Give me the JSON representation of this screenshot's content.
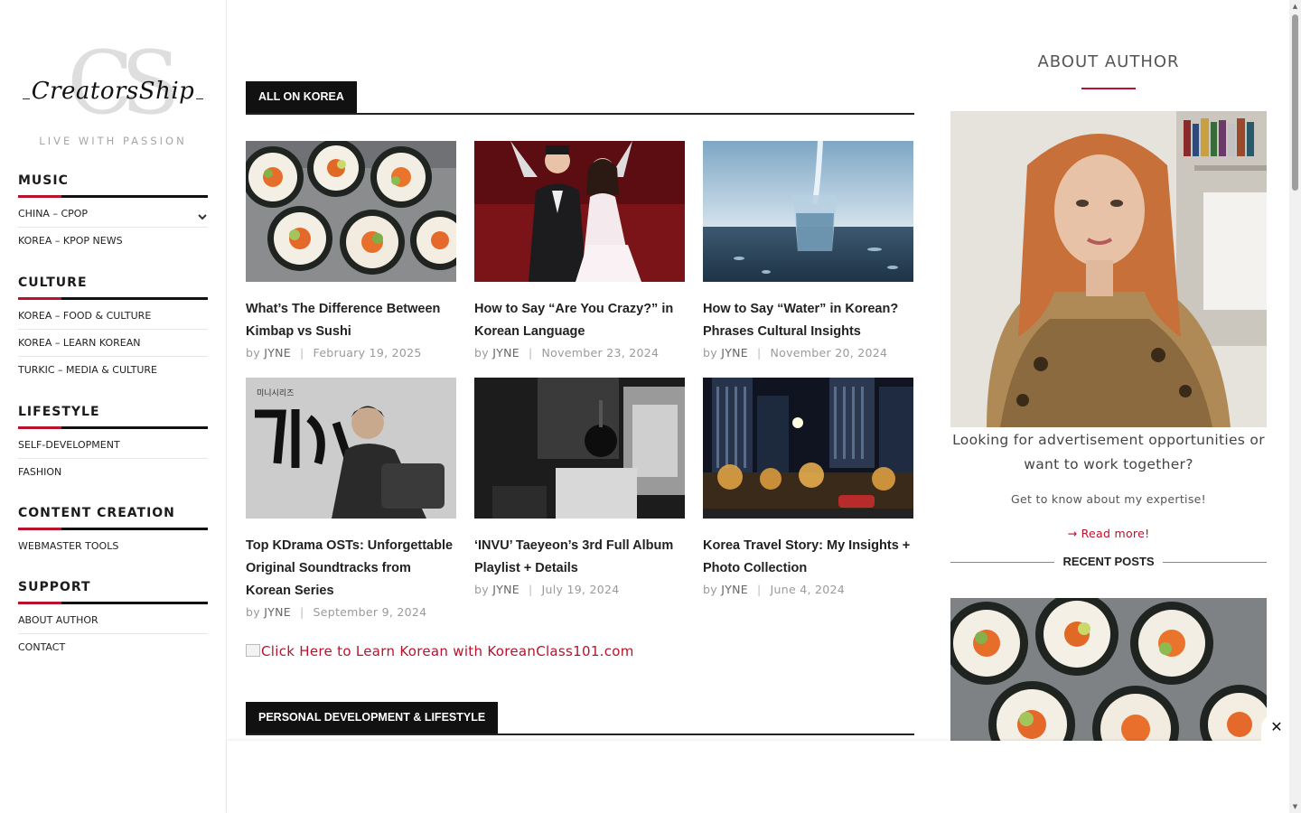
{
  "logo": {
    "monogram": "CS",
    "script": "CreatorsShip",
    "tagline": "LIVE WITH PASSION"
  },
  "sidebar": {
    "sections": [
      {
        "heading": "MUSIC",
        "items": [
          "CHINA – CPOP",
          "KOREA – KPOP NEWS"
        ]
      },
      {
        "heading": "CULTURE",
        "items": [
          "KOREA – FOOD & CULTURE",
          "KOREA – LEARN KOREAN",
          "TURKIC – MEDIA & CULTURE"
        ]
      },
      {
        "heading": "LIFESTYLE",
        "items": [
          "SELF-DEVELOPMENT",
          "FASHION"
        ]
      },
      {
        "heading": "CONTENT CREATION",
        "items": [
          "WEBMASTER TOOLS"
        ]
      },
      {
        "heading": "SUPPORT",
        "items": [
          "ABOUT AUTHOR",
          "CONTACT"
        ]
      }
    ]
  },
  "main": {
    "section1_title": "ALL ON KOREA",
    "section2_title": "PERSONAL DEVELOPMENT & LIFESTYLE",
    "korean_link": "Click Here to Learn Korean with KoreanClass101.com",
    "by_label": "by",
    "posts": [
      {
        "title": "What’s The Difference Between Kimbap vs Sushi",
        "author": "JYNE",
        "date": "February 19, 2025",
        "image": "kimbap-image"
      },
      {
        "title": "How to Say “Are You Crazy?” in Korean Language",
        "author": "JYNE",
        "date": "November 23, 2024",
        "image": "kdrama-couple-image"
      },
      {
        "title": "How to Say “Water” in Korean? Phrases Cultural Insights",
        "author": "JYNE",
        "date": "November 20, 2024",
        "image": "water-glass-image"
      },
      {
        "title": "Top KDrama OSTs: Unforgettable Original Soundtracks from Korean Series",
        "author": "JYNE",
        "date": "September 9, 2024",
        "image": "bad-guy-poster-image"
      },
      {
        "title": "‘INVU’ Taeyeon’s 3rd Full Album Playlist + Details",
        "author": "JYNE",
        "date": "July 19, 2024",
        "image": "recording-studio-image"
      },
      {
        "title": "Korea Travel Story: My Insights + Photo Collection",
        "author": "JYNE",
        "date": "June 4, 2024",
        "image": "seoul-night-image"
      }
    ]
  },
  "right": {
    "about_title": "ABOUT AUTHOR",
    "author_text": "Looking for advertisement opportunities or want to work together?",
    "author_sub": "Get to know about my expertise!",
    "read_more": "→ Read more!",
    "recent_title": "RECENT POSTS"
  },
  "overlay": {
    "close_label": "✕"
  },
  "colors": {
    "accent": "#b8122c",
    "dark": "#111111"
  }
}
